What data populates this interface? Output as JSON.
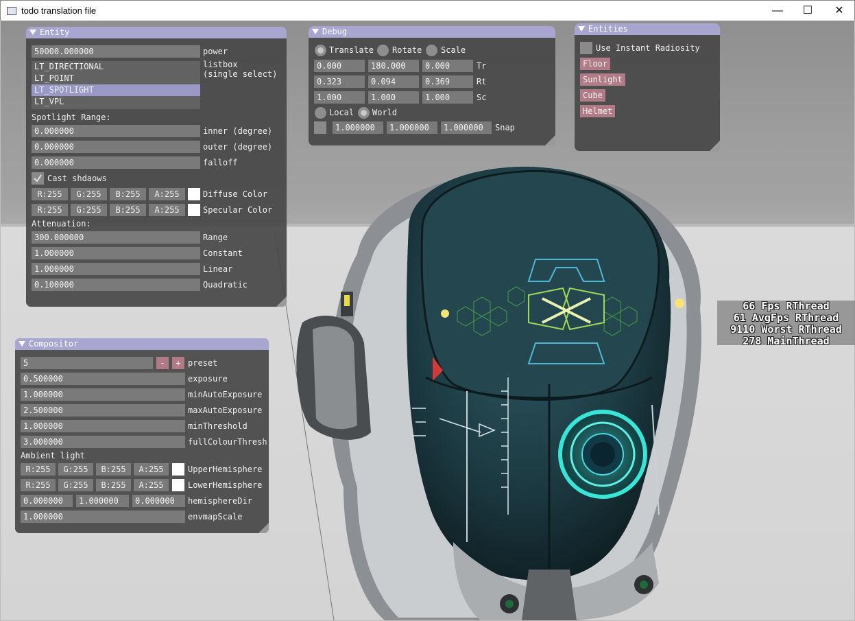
{
  "window": {
    "title": "todo translation file",
    "minimize": "—",
    "maximize": "☐",
    "close": "✕"
  },
  "stats": [
    "66 Fps RThread",
    "61 AvgFps RThread",
    "9110 Worst RThread",
    "278 MainThread"
  ],
  "entity": {
    "title": "Entity",
    "power_value": "50000.000000",
    "power_label": "power",
    "listbox_label": "listbox\n(single select)",
    "light_types": [
      "LT_DIRECTIONAL",
      "LT_POINT",
      "LT_SPOTLIGHT",
      "LT_VPL"
    ],
    "selected_index": 2,
    "spotlight_heading": "Spotlight Range:",
    "inner_value": "0.000000",
    "inner_label": "inner (degree)",
    "outer_value": "0.000000",
    "outer_label": "outer (degree)",
    "falloff_value": "0.000000",
    "falloff_label": "falloff",
    "cast_shadows_label": "Cast shdaows",
    "cast_shadows_checked": true,
    "diffuse": {
      "r": "R:255",
      "g": "G:255",
      "b": "B:255",
      "a": "A:255",
      "label": "Diffuse Color",
      "color": "#ffffff"
    },
    "specular": {
      "r": "R:255",
      "g": "G:255",
      "b": "B:255",
      "a": "A:255",
      "label": "Specular Color",
      "color": "#ffffff"
    },
    "attenuation_heading": "Attenuation:",
    "range_value": "300.000000",
    "range_label": "Range",
    "constant_value": "1.000000",
    "constant_label": "Constant",
    "linear_value": "1.000000",
    "linear_label": "Linear",
    "quadratic_value": "0.100000",
    "quadratic_label": "Quadratic"
  },
  "debug": {
    "title": "Debug",
    "translate_label": "Translate",
    "rotate_label": "Rotate",
    "scale_label": "Scale",
    "mode_selected": "Translate",
    "tr": [
      "0.000",
      "180.000",
      "0.000"
    ],
    "tr_label": "Tr",
    "rt": [
      "0.323",
      "0.094",
      "0.369"
    ],
    "rt_label": "Rt",
    "sc": [
      "1.000",
      "1.000",
      "1.000"
    ],
    "sc_label": "Sc",
    "local_label": "Local",
    "world_label": "World",
    "space_selected": "World",
    "snap": [
      "1.000000",
      "1.000000",
      "1.000000"
    ],
    "snap_label": "Snap"
  },
  "entities": {
    "title": "Entities",
    "instant_radiosity_label": "Use Instant Radiosity",
    "buttons": [
      "Floor",
      "Sunlight",
      "Cube",
      "Helmet"
    ]
  },
  "compositor": {
    "title": "Compositor",
    "preset_value": "5",
    "preset_minus": "-",
    "preset_plus": "+",
    "preset_label": "preset",
    "exposure_value": "0.500000",
    "exposure_label": "exposure",
    "min_auto_value": "1.000000",
    "min_auto_label": "minAutoExposure",
    "max_auto_value": "2.500000",
    "max_auto_label": "maxAutoExposure",
    "min_threshold_value": "1.000000",
    "min_threshold_label": "minThreshold",
    "full_colour_value": "3.000000",
    "full_colour_label": "fullColourThresho",
    "ambient_heading": "Ambient light",
    "upper": {
      "r": "R:255",
      "g": "G:255",
      "b": "B:255",
      "a": "A:255",
      "label": "UpperHemisphere C",
      "color": "#ffffff"
    },
    "lower": {
      "r": "R:255",
      "g": "G:255",
      "b": "B:255",
      "a": "A:255",
      "label": "LowerHemisphere C",
      "color": "#ffffff"
    },
    "hemisphere_dir": [
      "0.000000",
      "1.000000",
      "0.000000"
    ],
    "hemisphere_dir_label": "hemisphereDir",
    "envmap_value": "1.000000",
    "envmap_label": "envmapScale"
  }
}
